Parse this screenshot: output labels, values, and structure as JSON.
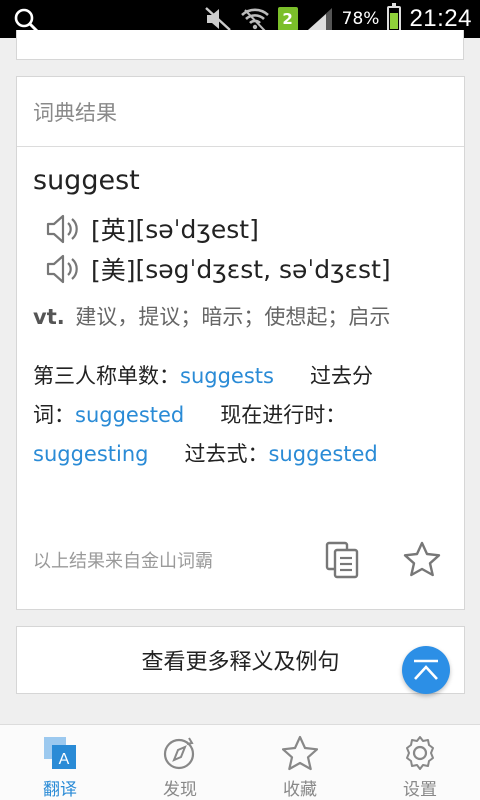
{
  "status_bar": {
    "sim": "2",
    "battery_percent": "78%",
    "battery_level": 0.78,
    "time": "21:24"
  },
  "dictionary": {
    "header": "词典结果",
    "word": "suggest",
    "pronunciations": [
      {
        "label": "[英]",
        "ipa": "[səˈdʒest]"
      },
      {
        "label": "[美]",
        "ipa": "[səgˈdʒɛst, səˈdʒɛst]"
      }
    ],
    "definition": {
      "pos": "vt.",
      "meaning": "建议，提议；暗示；使想起；启示"
    },
    "forms": [
      {
        "label": "第三人称单数：",
        "value": "suggests"
      },
      {
        "label": "过去分词：",
        "value": "suggested"
      },
      {
        "label": "现在进行时：",
        "value": "suggesting"
      },
      {
        "label": "过去式：",
        "value": "suggested"
      }
    ],
    "source": "以上结果来自金山词霸"
  },
  "more_button": "查看更多释义及例句",
  "bottom_nav": {
    "items": [
      {
        "label": "翻译",
        "active": true
      },
      {
        "label": "发现",
        "active": false
      },
      {
        "label": "收藏",
        "active": false
      },
      {
        "label": "设置",
        "active": false
      }
    ]
  },
  "colors": {
    "accent": "#2a8bd6",
    "fab": "#2c8fe6"
  }
}
